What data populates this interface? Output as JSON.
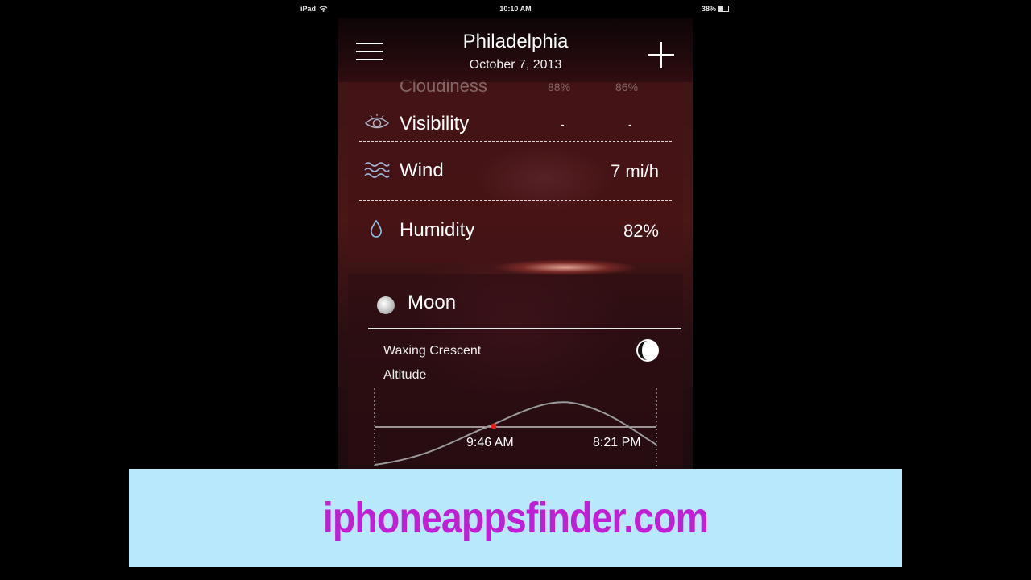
{
  "status_bar": {
    "device": "iPad",
    "time": "10:10 AM",
    "battery": "38%"
  },
  "header": {
    "city": "Philadelphia",
    "date": "October 7, 2013"
  },
  "details": {
    "cloudiness": {
      "label": "Cloudiness",
      "value1": "88%",
      "value2": "86%"
    },
    "visibility": {
      "label": "Visibility",
      "value1": "-",
      "value2": "-"
    },
    "wind": {
      "label": "Wind",
      "value": "7 mi/h"
    },
    "humidity": {
      "label": "Humidity",
      "value": "82%"
    }
  },
  "moon": {
    "title": "Moon",
    "phase": "Waxing Crescent",
    "altitude_label": "Altitude",
    "rise_time": "9:46 AM",
    "set_time": "8:21 PM"
  },
  "banner": {
    "text": "iphoneappsfinder.com"
  },
  "colors": {
    "banner_bg": "#b7e8fb",
    "banner_text": "#c01fd6",
    "marker": "#e0201e"
  }
}
